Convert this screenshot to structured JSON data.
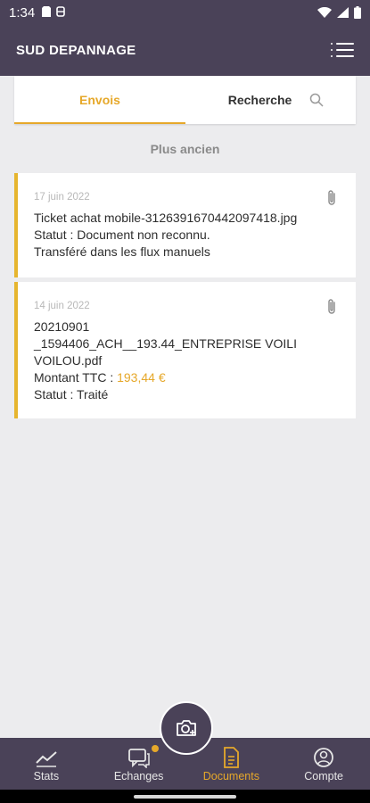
{
  "status_bar": {
    "time": "1:34"
  },
  "header": {
    "title": "SUD DEPANNAGE"
  },
  "tabs": [
    {
      "label": "Envois",
      "active": true
    },
    {
      "label": "Recherche",
      "active": false
    }
  ],
  "list_header": "Plus ancien",
  "cards": [
    {
      "date": "17 juin 2022",
      "lines": [
        "Ticket achat mobile-3126391670442097418.jpg",
        "Statut : Document non reconnu.",
        "Transféré dans les flux manuels"
      ]
    },
    {
      "date": "14 juin 2022",
      "line1": "20210901",
      "line2": "_1594406_ACH__193.44_ENTREPRISE VOILI",
      "line3": "VOILOU.pdf",
      "amount_label": "Montant TTC : ",
      "amount_value": "193,44 €",
      "status": "Statut : Traité"
    }
  ],
  "bottom_nav": [
    {
      "label": "Stats",
      "icon": "stats-icon"
    },
    {
      "label": "Echanges",
      "icon": "chat-icon",
      "badge": true
    },
    {
      "label": "Documents",
      "icon": "document-icon",
      "active": true
    },
    {
      "label": "Compte",
      "icon": "account-icon"
    }
  ],
  "colors": {
    "accent": "#e6a82a",
    "bar": "#4a4258",
    "card_border": "#e6b52e"
  }
}
